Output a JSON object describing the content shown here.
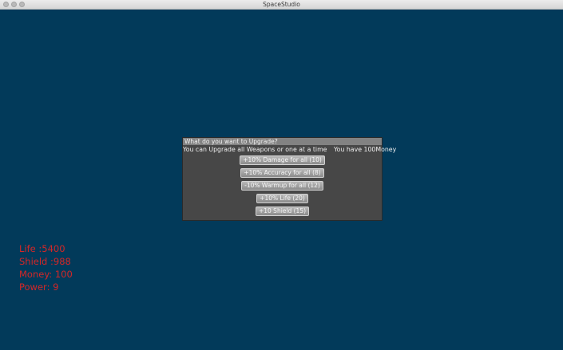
{
  "window": {
    "title": "SpaceStudio"
  },
  "dialog": {
    "header": "What do you want to Upgrade?",
    "subtitle": "You can Upgrade all Weapons or one at a time",
    "money_note": "You have 100Money",
    "buttons": [
      {
        "label": "+10% Damage for  all (10)"
      },
      {
        "label": "+10% Accuracy for  all (8)"
      },
      {
        "label": "-10% Warmup for  all (12)"
      },
      {
        "label": "+10% Life (20)"
      },
      {
        "label": "+10 Shield  (15)"
      }
    ]
  },
  "stats": {
    "life": "Life :5400",
    "shield": "Shield :988",
    "money": "Money: 100",
    "power": "Power: 9"
  },
  "colors": {
    "background": "#023a5a",
    "stats_text": "#d42727",
    "dialog_bg": "#474747"
  }
}
